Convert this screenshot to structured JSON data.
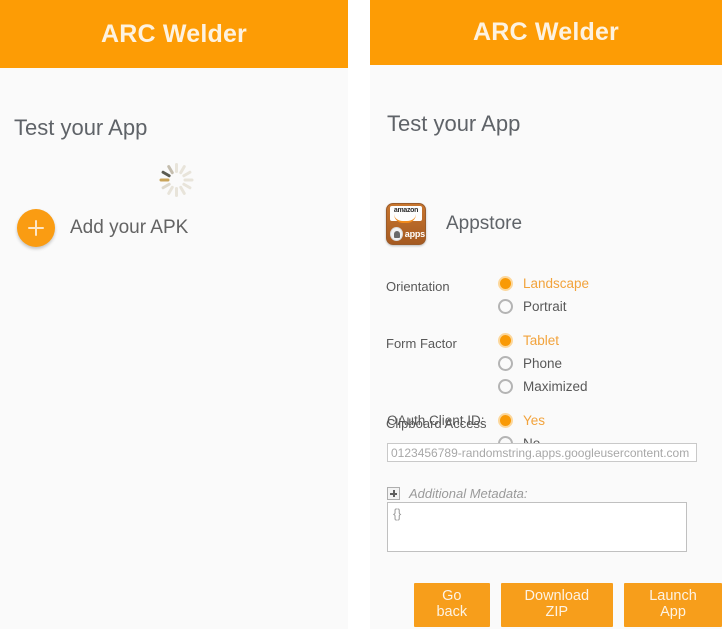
{
  "left_panel": {
    "header_title": "ARC Welder",
    "section_title": "Test your App",
    "spinner_name": "loading-spinner",
    "add_apk_label": "Add your APK"
  },
  "right_panel": {
    "header_title": "ARC Welder",
    "section_title": "Test your App",
    "app": {
      "icon_name": "amazon-appstore-icon",
      "icon_brand_text": "amazon",
      "icon_sub_text": "apps",
      "name": "Appstore"
    },
    "options": [
      {
        "label": "Orientation",
        "choices": [
          {
            "text": "Landscape",
            "selected": true
          },
          {
            "text": "Portrait",
            "selected": false
          }
        ]
      },
      {
        "label": "Form Factor",
        "choices": [
          {
            "text": "Tablet",
            "selected": true
          },
          {
            "text": "Phone",
            "selected": false
          },
          {
            "text": "Maximized",
            "selected": false
          }
        ]
      },
      {
        "label": "Clipboard Access",
        "choices": [
          {
            "text": "Yes",
            "selected": true
          },
          {
            "text": "No",
            "selected": false
          }
        ]
      }
    ],
    "oauth": {
      "label": "OAuth Client ID:",
      "value": "",
      "placeholder": "0123456789-randomstring.apps.googleusercontent.com"
    },
    "metadata": {
      "expand_icon_name": "expand-plus-icon",
      "label": "Additional Metadata:",
      "value": "{}",
      "placeholder": "{}"
    },
    "buttons": [
      {
        "label": "Go back"
      },
      {
        "label": "Download ZIP"
      },
      {
        "label": "Launch App"
      }
    ]
  },
  "colors": {
    "accent": "#fd9c05",
    "button": "#f79e1b",
    "panel_bg": "#fafafa",
    "selected_text": "#f2a33c"
  }
}
